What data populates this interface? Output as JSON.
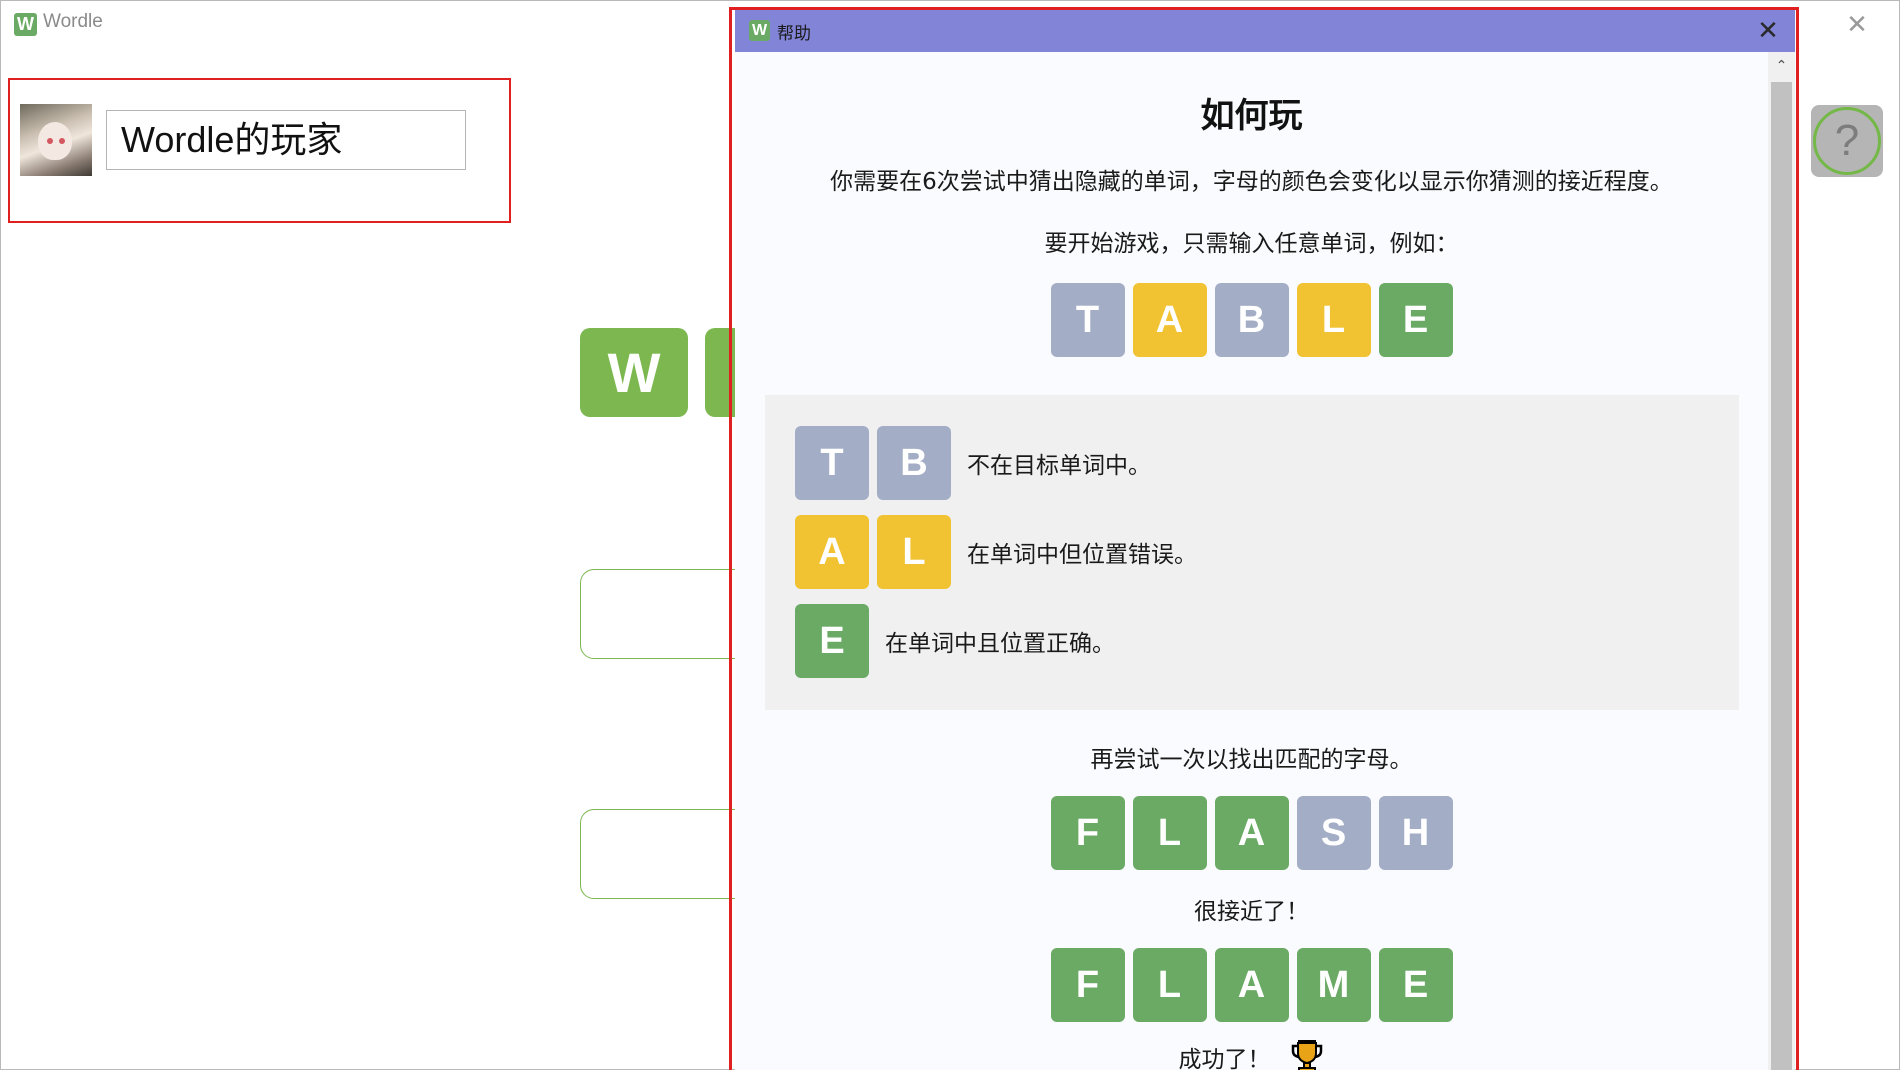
{
  "app": {
    "title": "Wordle",
    "icon_letter": "W",
    "close_glyph": "✕"
  },
  "profile": {
    "player_name": "Wordle的玩家",
    "avatar_icon": "avatar-image"
  },
  "logo_tiles": [
    "W",
    ""
  ],
  "help_button": {
    "glyph": "?"
  },
  "dialog": {
    "title": "帮助",
    "icon_letter": "W",
    "close_glyph": "✕",
    "heading": "如何玩",
    "intro": "你需要在6次尝试中猜出隐藏的单词，字母的颜色会变化以显示你猜测的接近程度。",
    "start_text": "要开始游戏，只需输入任意单词，例如：",
    "example_word": [
      {
        "letter": "T",
        "state": "gray"
      },
      {
        "letter": "A",
        "state": "yellow"
      },
      {
        "letter": "B",
        "state": "gray"
      },
      {
        "letter": "L",
        "state": "yellow"
      },
      {
        "letter": "E",
        "state": "green"
      }
    ],
    "legend": [
      {
        "letters": [
          "T",
          "B"
        ],
        "state": "gray",
        "text": "不在目标单词中。"
      },
      {
        "letters": [
          "A",
          "L"
        ],
        "state": "yellow",
        "text": "在单词中但位置错误。"
      },
      {
        "letters": [
          "E"
        ],
        "state": "green",
        "text": "在单词中且位置正确。"
      }
    ],
    "retry_text": "再尝试一次以找出匹配的字母。",
    "second_word": [
      {
        "letter": "F",
        "state": "green"
      },
      {
        "letter": "L",
        "state": "green"
      },
      {
        "letter": "A",
        "state": "green"
      },
      {
        "letter": "S",
        "state": "gray"
      },
      {
        "letter": "H",
        "state": "gray"
      }
    ],
    "close_text": "很接近了！",
    "final_word": [
      {
        "letter": "F",
        "state": "green"
      },
      {
        "letter": "L",
        "state": "green"
      },
      {
        "letter": "A",
        "state": "green"
      },
      {
        "letter": "M",
        "state": "green"
      },
      {
        "letter": "E",
        "state": "green"
      }
    ],
    "success_text": "成功了！",
    "scroll_up_glyph": "⌃"
  },
  "colors": {
    "green": "#6aaa64",
    "yellow": "#f1c232",
    "gray": "#a3aec6",
    "dialog_titlebar": "#8284d8",
    "highlight": "#e02020"
  }
}
